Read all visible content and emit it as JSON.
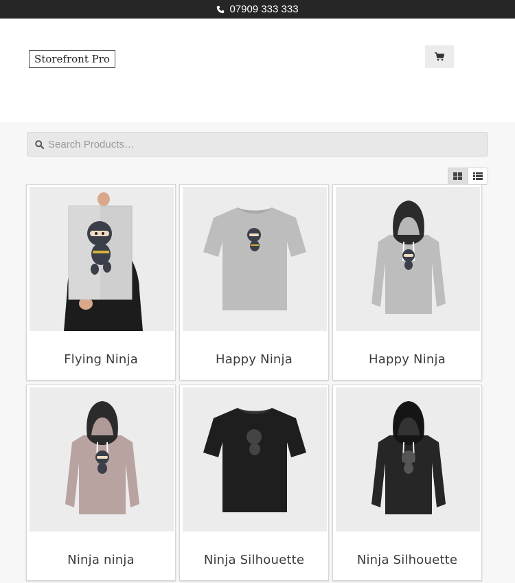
{
  "topbar": {
    "phone_icon": "phone-icon",
    "phone": "07909 333 333"
  },
  "header": {
    "logo": "Storefront Pro",
    "cart_icon": "cart-icon"
  },
  "search": {
    "placeholder": "Search Products…",
    "icon": "search-icon"
  },
  "view_toggle": {
    "grid_icon": "grid-view-icon",
    "list_icon": "list-view-icon",
    "active": "grid"
  },
  "products": [
    {
      "name": "Flying Ninja",
      "image": "poster"
    },
    {
      "name": "Happy Ninja",
      "image": "tshirt-grey"
    },
    {
      "name": "Happy Ninja",
      "image": "hoodie-grey"
    },
    {
      "name": "Ninja ninja",
      "image": "hoodie-pink"
    },
    {
      "name": "Ninja Silhouette",
      "image": "tshirt-black"
    },
    {
      "name": "Ninja Silhouette",
      "image": "hoodie-black"
    }
  ]
}
